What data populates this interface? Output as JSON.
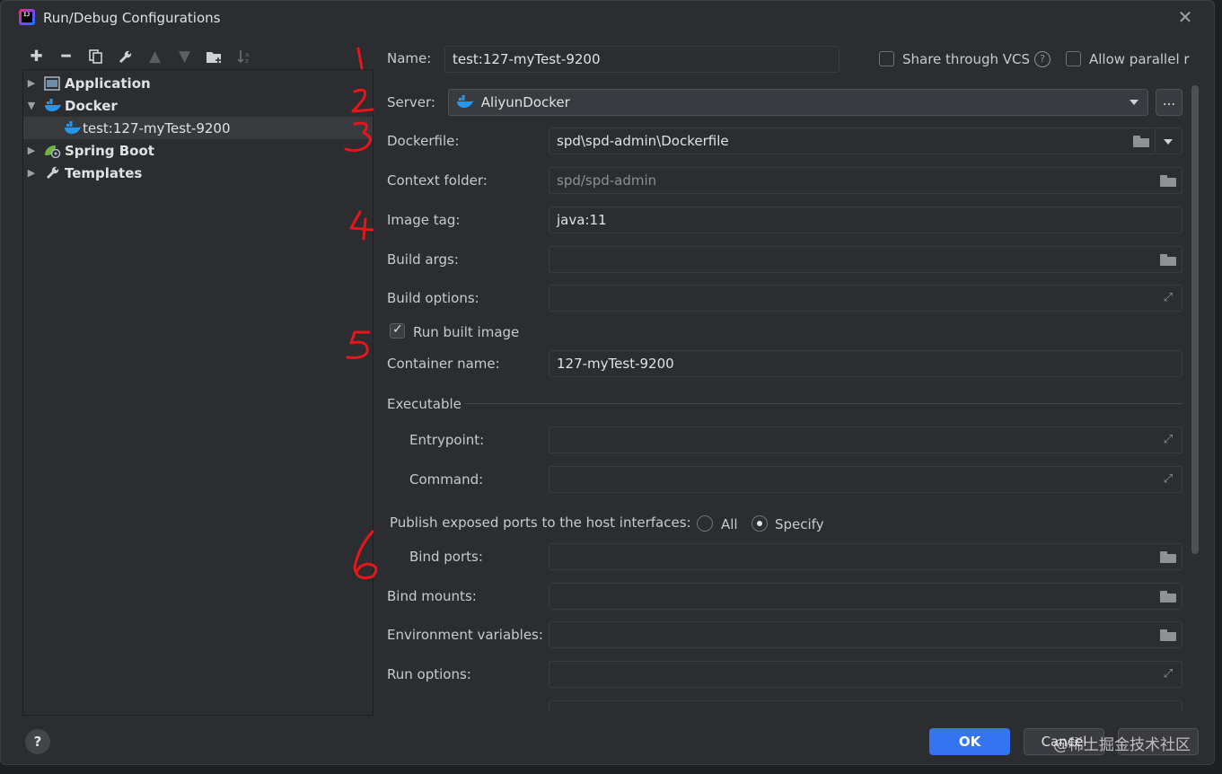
{
  "window": {
    "title": "Run/Debug Configurations"
  },
  "toolbar": {
    "buttons": [
      "add-icon",
      "remove-icon",
      "copy-icon",
      "wrench-icon",
      "move-up-icon",
      "move-down-icon",
      "new-folder-icon",
      "sort-icon"
    ]
  },
  "tree": {
    "items": [
      {
        "label": "Application",
        "icon": "application-icon"
      },
      {
        "label": "Docker",
        "icon": "docker-icon"
      },
      {
        "label": "test:127-myTest-9200",
        "icon": "docker-icon"
      },
      {
        "label": "Spring Boot",
        "icon": "spring-boot-icon"
      },
      {
        "label": "Templates",
        "icon": "wrench-icon"
      }
    ]
  },
  "form": {
    "name_label": "Name:",
    "name_value": "test:127-myTest-9200",
    "share_vcs_label": "Share through VCS",
    "allow_parallel_label": "Allow parallel run",
    "server_label": "Server:",
    "server_value": "AliyunDocker",
    "server_more": "...",
    "dockerfile_label": "Dockerfile:",
    "dockerfile_value": "spd\\spd-admin\\Dockerfile",
    "context_label": "Context folder:",
    "context_value": "spd/spd-admin",
    "image_tag_label": "Image tag:",
    "image_tag_value": "java:11",
    "build_args_label": "Build args:",
    "build_options_label": "Build options:",
    "run_built_image_label": "Run built image",
    "container_name_label": "Container name:",
    "container_name_value": "127-myTest-9200",
    "executable_label": "Executable",
    "entrypoint_label": "Entrypoint:",
    "command_label": "Command:",
    "publish_ports_label": "Publish exposed ports to the host interfaces:",
    "radio_all_label": "All",
    "radio_specify_label": "Specify",
    "bind_ports_label": "Bind ports:",
    "bind_mounts_label": "Bind mounts:",
    "env_vars_label": "Environment variables:",
    "run_options_label": "Run options:"
  },
  "footer": {
    "ok_label": "OK",
    "cancel_label": "Cancel",
    "watermark": "@稀土掘金技术社区"
  },
  "annotations": [
    "1",
    "2",
    "3",
    "4",
    "5",
    "6"
  ],
  "colors": {
    "accent": "#3574f0",
    "annotation": "#e8151b",
    "docker": "#2496ed"
  }
}
